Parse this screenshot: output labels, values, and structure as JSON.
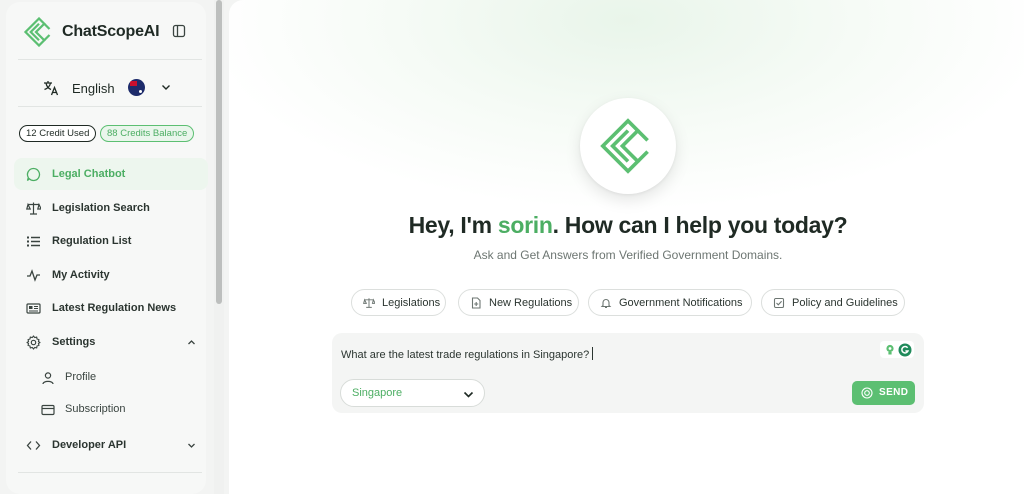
{
  "app": {
    "brand_name": "ChatScopeAI",
    "accent_color": "#5cbf72"
  },
  "sidebar": {
    "language": {
      "label": "English",
      "icon": "translate-icon",
      "flag": "flag-icon"
    },
    "credits": {
      "used": "12 Credit Used",
      "balance": "88 Credits Balance"
    },
    "items": [
      {
        "label": "Legal Chatbot",
        "icon": "chat-bubble-icon",
        "active": true
      },
      {
        "label": "Legislation Search",
        "icon": "scale-icon"
      },
      {
        "label": "Regulation List",
        "icon": "list-icon"
      },
      {
        "label": "My Activity",
        "icon": "activity-icon"
      },
      {
        "label": "Latest Regulation News",
        "icon": "newspaper-icon"
      },
      {
        "label": "Settings",
        "icon": "gear-icon",
        "expanded": true,
        "children": [
          {
            "label": "Profile",
            "icon": "user-icon"
          },
          {
            "label": "Subscription",
            "icon": "credit-card-icon"
          }
        ]
      },
      {
        "label": "Developer API",
        "icon": "code-icon",
        "expanded": false
      }
    ]
  },
  "main": {
    "greeting_prefix": "Hey, I'm ",
    "greeting_name": "sorin",
    "greeting_suffix": ". How can I help you today?",
    "subtitle": "Ask and Get Answers from Verified Government Domains.",
    "chips": [
      {
        "label": "Legislations",
        "icon": "scale-icon"
      },
      {
        "label": "New Regulations",
        "icon": "document-plus-icon"
      },
      {
        "label": "Government Notifications",
        "icon": "bell-icon"
      },
      {
        "label": "Policy and Guidelines",
        "icon": "checklist-icon"
      }
    ],
    "composer": {
      "input_value": "What are the latest trade regulations in Singapore?",
      "country": "Singapore",
      "send_label": "SEND"
    }
  }
}
